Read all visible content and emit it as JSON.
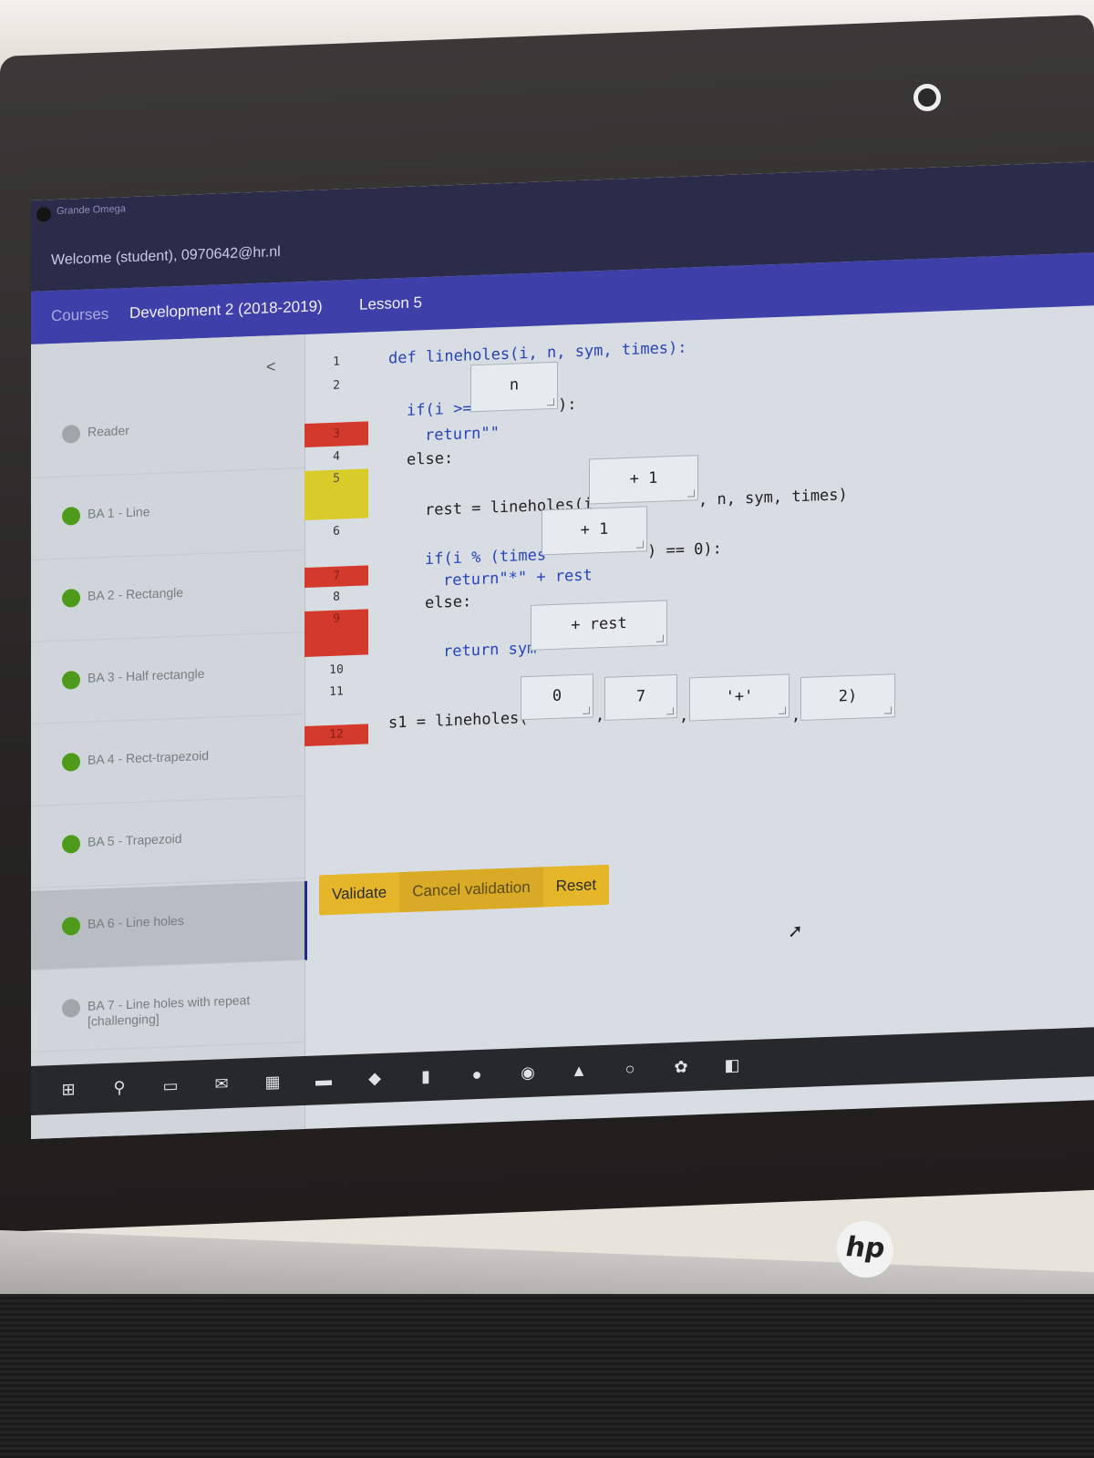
{
  "app": {
    "name": "Grande Omega",
    "welcome": "Welcome (student), 0970642@hr.nl"
  },
  "breadcrumb": [
    "Courses",
    "Development 2 (2018-2019)",
    "Lesson 5"
  ],
  "sidebar": {
    "collapse_glyph": "<",
    "items": [
      {
        "label": "Reader",
        "status": "grey"
      },
      {
        "label": "BA 1 - Line",
        "status": "green"
      },
      {
        "label": "BA 2 - Rectangle",
        "status": "green"
      },
      {
        "label": "BA 3 - Half rectangle",
        "status": "green"
      },
      {
        "label": "BA 4 - Rect-trapezoid",
        "status": "green"
      },
      {
        "label": "BA 5 - Trapezoid",
        "status": "green"
      },
      {
        "label": "BA 6 - Line holes",
        "status": "green",
        "active": true
      },
      {
        "label": "BA 7 - Line holes with repeat [challenging]",
        "status": "grey"
      }
    ]
  },
  "editor": {
    "line_numbers": [
      "1",
      "2",
      "3",
      "4",
      "5",
      "6",
      "7",
      "8",
      "9",
      "10",
      "11",
      "12"
    ],
    "line_status": {
      "3": "red",
      "5": "yellow",
      "7": "red",
      "9": "red",
      "12": "red"
    },
    "code": {
      "l1": "def lineholes(i, n, sym, times):",
      "l2a": "if(i >=",
      "l2b": "):",
      "l3": "return\"\"",
      "l4": "else:",
      "l5a": "rest = lineholes(i",
      "l5b": ", n, sym, times)",
      "l6a": "if(i % (times",
      "l6b": ") == 0):",
      "l7": "return\"*\" + rest",
      "l8": "else:",
      "l9": "return sym",
      "l11": "s1 = lineholes(",
      "comma": ","
    },
    "slots": {
      "s_if": "n",
      "s_rest": "+ 1",
      "s_times": "+ 1",
      "s_sym": "+ rest",
      "s_arg1": "0",
      "s_arg2": "7",
      "s_arg3": "'+'",
      "s_arg4": "2)"
    }
  },
  "actions": {
    "validate": "Validate",
    "cancel": "Cancel validation",
    "reset": "Reset"
  },
  "taskbar": {
    "icons": [
      "windows-start-icon",
      "search-icon",
      "task-view-icon",
      "mail-icon",
      "calendar-icon",
      "file-explorer-icon",
      "python-icon",
      "editor-icon",
      "app-icon",
      "chrome-icon",
      "photos-icon",
      "terminal-icon",
      "scratch-icon",
      "vscode-icon"
    ]
  },
  "laptop": {
    "brand": "hp"
  }
}
